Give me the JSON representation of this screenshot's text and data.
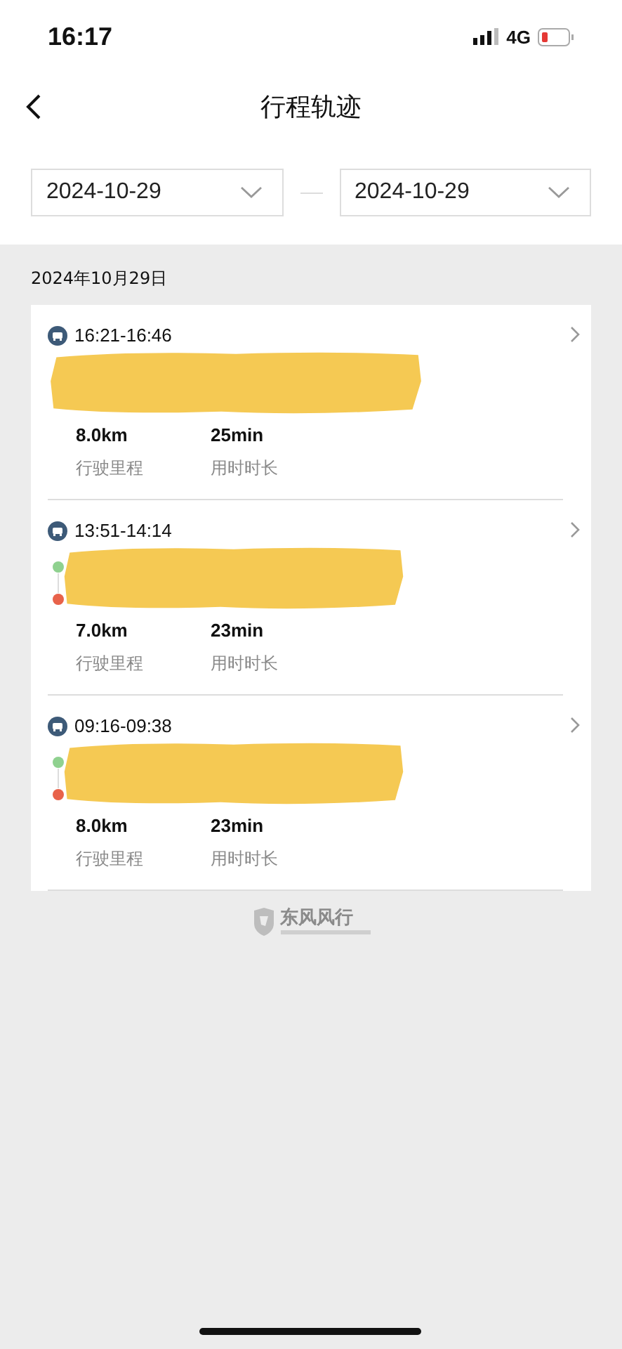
{
  "status_bar": {
    "time": "16:17",
    "network": "4G"
  },
  "nav": {
    "title": "行程轨迹"
  },
  "date_range": {
    "start": "2024-10-29",
    "end": "2024-10-29"
  },
  "day": {
    "label": "2024年10月29日"
  },
  "trips": [
    {
      "time": "16:21-16:46",
      "endpoints_shown": false,
      "distance": "8.0km",
      "distance_label": "行驶里程",
      "duration": "25min",
      "duration_label": "用时时长"
    },
    {
      "time": "13:51-14:14",
      "endpoints_shown": true,
      "distance": "7.0km",
      "distance_label": "行驶里程",
      "duration": "23min",
      "duration_label": "用时时长"
    },
    {
      "time": "09:16-09:38",
      "endpoints_shown": true,
      "distance": "8.0km",
      "distance_label": "行驶里程",
      "duration": "23min",
      "duration_label": "用时时长"
    }
  ],
  "footer": {
    "brand": "东风风行"
  }
}
